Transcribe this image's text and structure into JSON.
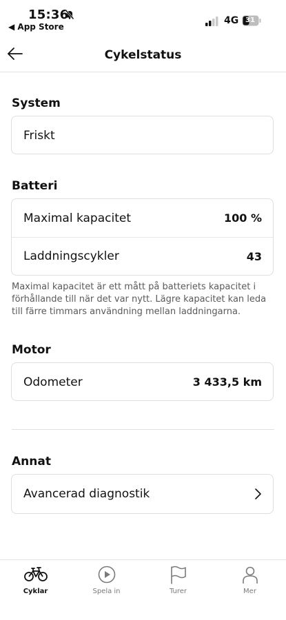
{
  "status_bar": {
    "time": "15:36",
    "back_app": "◀ App Store",
    "network": "4G",
    "battery": "31"
  },
  "header": {
    "title": "Cykelstatus"
  },
  "sections": {
    "system": {
      "title": "System",
      "value": "Friskt"
    },
    "battery": {
      "title": "Batteri",
      "rows": [
        {
          "label": "Maximal kapacitet",
          "value": "100 %"
        },
        {
          "label": "Laddningscykler",
          "value": "43"
        }
      ],
      "note": "Maximal kapacitet är ett mått på batteriets kapacitet i förhållande till när det var nytt. Lägre kapacitet kan leda till färre timmars användning mellan laddningarna."
    },
    "motor": {
      "title": "Motor",
      "rows": [
        {
          "label": "Odometer",
          "value": "3 433,5 km"
        }
      ]
    },
    "other": {
      "title": "Annat",
      "rows": [
        {
          "label": "Avancerad diagnostik"
        }
      ]
    }
  },
  "tab_bar": {
    "items": [
      {
        "label": "Cyklar",
        "icon": "bike-icon",
        "active": true
      },
      {
        "label": "Spela in",
        "icon": "play-icon",
        "active": false
      },
      {
        "label": "Turer",
        "icon": "flag-icon",
        "active": false
      },
      {
        "label": "Mer",
        "icon": "person-icon",
        "active": false
      }
    ]
  }
}
